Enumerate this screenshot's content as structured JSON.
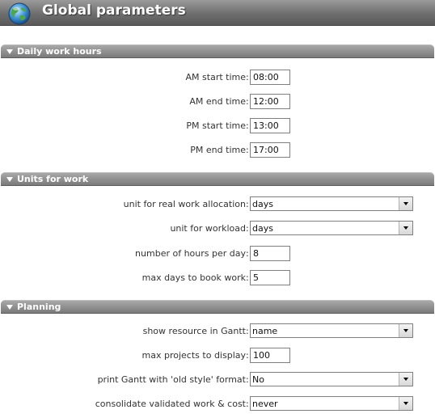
{
  "header": {
    "title": "Global parameters",
    "icon": "globe-icon"
  },
  "sections": {
    "daily": {
      "title": "Daily work hours",
      "rows": [
        {
          "label": "AM start time",
          "value": "08:00"
        },
        {
          "label": "AM end time",
          "value": "12:00"
        },
        {
          "label": "PM start time",
          "value": "13:00"
        },
        {
          "label": "PM end time",
          "value": "17:00"
        }
      ]
    },
    "units": {
      "title": "Units for work",
      "rows": [
        {
          "label": "unit for real work allocation",
          "value": "days"
        },
        {
          "label": "unit for workload",
          "value": "days"
        },
        {
          "label": "number of hours per day",
          "value": "8"
        },
        {
          "label": "max days to book work",
          "value": "5"
        }
      ]
    },
    "planning": {
      "title": "Planning",
      "rows": [
        {
          "label": "show resource in Gantt",
          "value": "name"
        },
        {
          "label": "max projects to display",
          "value": "100"
        },
        {
          "label": "print Gantt with 'old style' format",
          "value": "No"
        },
        {
          "label": "consolidate validated work & cost",
          "value": "never"
        }
      ]
    }
  },
  "separator": ":",
  "colors": {
    "section_bar": "#8a8a8a",
    "header_bar": "#6e6e6e"
  }
}
